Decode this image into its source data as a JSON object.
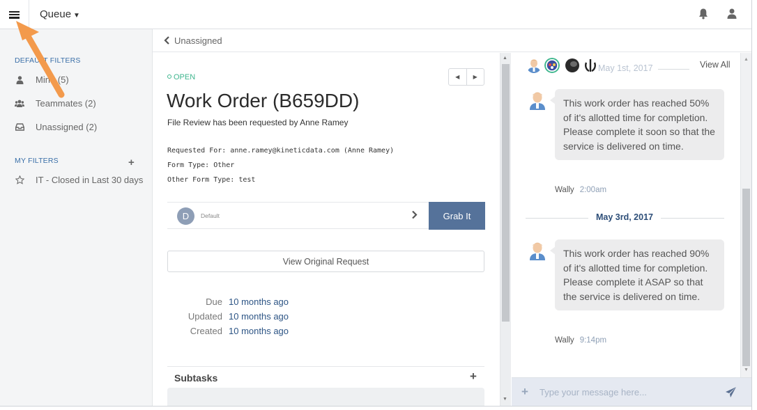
{
  "topbar": {
    "menu_icon": "hamburger-icon",
    "queue_label": "Queue",
    "notification_icon": "bell-icon",
    "user_icon": "user-icon"
  },
  "sidebar": {
    "default_filters_label": "DEFAULT FILTERS",
    "default_items": [
      {
        "label": "Mine (5)",
        "icon": "user-icon"
      },
      {
        "label": "Teammates (2)",
        "icon": "users-icon"
      },
      {
        "label": "Unassigned (2)",
        "icon": "inbox-icon"
      }
    ],
    "my_filters_label": "MY FILTERS",
    "my_items": [
      {
        "label": "IT - Closed in Last 30 days",
        "icon": "star-icon"
      }
    ]
  },
  "breadcrumb": {
    "back_label": "Unassigned"
  },
  "work_order": {
    "status": "OPEN",
    "title": "Work Order (B659DD)",
    "summary": "File Review has been requested by Anne Ramey",
    "fields": [
      "Requested For: anne.ramey@kineticdata.com (Anne Ramey)",
      "Form Type: Other",
      "Other Form Type: test"
    ],
    "assignment": {
      "avatar_letter": "D",
      "team": "Default",
      "grab_label": "Grab It"
    },
    "view_original_label": "View Original Request",
    "dates": [
      {
        "key": "Due",
        "value": "10 months ago"
      },
      {
        "key": "Updated",
        "value": "10 months ago"
      },
      {
        "key": "Created",
        "value": "10 months ago"
      }
    ],
    "subtasks_label": "Subtasks"
  },
  "chat": {
    "view_all_label": "View All",
    "messages": [
      {
        "date": "May 1st, 2017",
        "text": "This work order has reached 50% of it's allotted time for completion. Please complete it soon so that the service is delivered on time.",
        "sender": "Wally",
        "time": "2:00am"
      },
      {
        "date": "May 3rd, 2017",
        "text": "This work order has reached 90% of it's allotted time for completion. Please complete it ASAP so that the service is delivered on time.",
        "sender": "Wally",
        "time": "9:14pm"
      }
    ],
    "composer_placeholder": "Type your message here...",
    "colors": {
      "accent": "#55729a",
      "status_open": "#3fb68e",
      "link": "#2d5585",
      "annotation_arrow": "#f39a4c"
    }
  }
}
